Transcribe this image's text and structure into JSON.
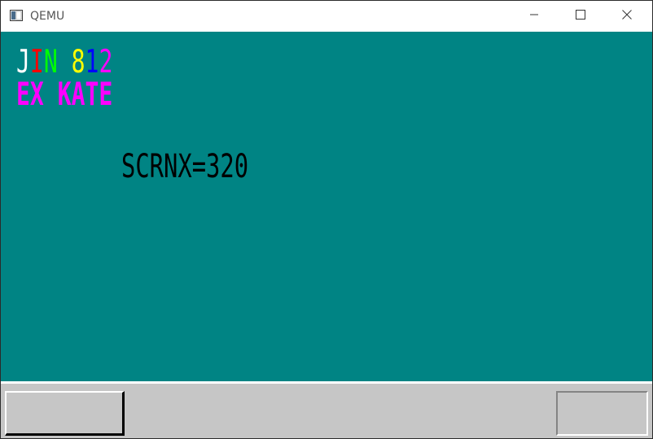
{
  "window": {
    "title": "QEMU",
    "buttons": [
      "minimize-icon",
      "maximize-icon",
      "close-icon"
    ]
  },
  "screen": {
    "background": "#008484",
    "line1": [
      {
        "text": "J",
        "color": "#ffffff"
      },
      {
        "text": "I",
        "color": "#ff0000"
      },
      {
        "text": "N",
        "color": "#00ff00"
      },
      {
        "text": " ",
        "color": "#ffffff"
      },
      {
        "text": "8",
        "color": "#ffff00"
      },
      {
        "text": "1",
        "color": "#0000ff"
      },
      {
        "text": "2",
        "color": "#ff00ff"
      }
    ],
    "line2": {
      "text": "EX KATE",
      "color": "#ff00ff"
    },
    "line3": {
      "text": "SCRNX=320",
      "color": "#000000"
    }
  },
  "taskbar": {
    "background": "#c6c6c6"
  }
}
